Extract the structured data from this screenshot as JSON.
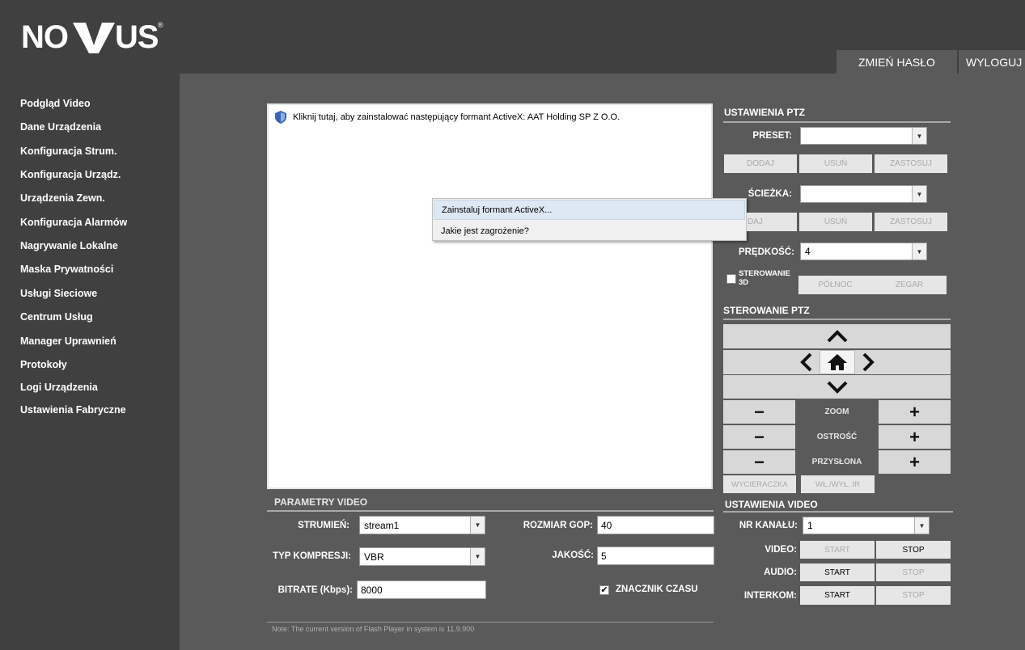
{
  "brand": {
    "logo_text": "NOVUS",
    "registered": "®"
  },
  "header": {
    "change_password": "ZMIEŃ HASŁO",
    "logout": "WYLOGUJ"
  },
  "sidebar": {
    "items": [
      "Podgląd Video",
      "Dane Urządzenia",
      "Konfiguracja Strum.",
      "Konfiguracja Urządz.",
      "Urządzenia Zewn.",
      "Konfiguracja Alarmów",
      "Nagrywanie Lokalne",
      "Maska Prywatności",
      "Usługi Sieciowe",
      "Centrum Usług",
      "Manager Uprawnień",
      "Protokoły",
      "Logi Urządzenia",
      "Ustawienia Fabryczne"
    ]
  },
  "viewer": {
    "activex_bar": "Kliknij tutaj, aby zainstalować następujący formant ActiveX: AAT Holding  SP Z O.O.",
    "menu": [
      "Zainstaluj formant ActiveX...",
      "Jakie jest zagrożenie?"
    ]
  },
  "ptz_settings": {
    "title": "USTAWIENIA PTZ",
    "preset_label": "PRESET:",
    "preset_value": "",
    "path_label": "ŚCIEŻKA:",
    "path_value": "",
    "speed_label": "PRĘDKOŚĆ:",
    "speed_value": "4",
    "add": "DODAJ",
    "remove": "USUŃ",
    "apply": "ZASTOSUJ",
    "add_partial": "DAJ",
    "control3d_label": "STEROWANIE 3D",
    "north": "PÓŁNOC",
    "clock": "ZEGAR"
  },
  "ptz_control": {
    "title": "STEROWANIE PTZ",
    "zoom": "ZOOM",
    "focus": "OSTROŚĆ",
    "iris": "PRZYSŁONA",
    "minus": "−",
    "plus": "+",
    "wiper": "WYCIERACZKA",
    "ir": "WŁ./WYŁ. IR"
  },
  "video_params": {
    "title": "PARAMETRY VIDEO",
    "stream_label": "STRUMIEŃ:",
    "stream_value": "stream1",
    "gop_label": "ROZMIAR GOP:",
    "gop_value": "40",
    "compression_label": "TYP KOMPRESJI:",
    "compression_value": "VBR",
    "quality_label": "JAKOŚĆ:",
    "quality_value": "5",
    "bitrate_label": "BITRATE (Kbps):",
    "bitrate_value": "8000",
    "timestamp_label": "ZNACZNIK CZASU",
    "timestamp_checked": true,
    "note": "Note: The current version of Flash Player in system is 11.9.900"
  },
  "video_settings": {
    "title": "USTAWIENIA VIDEO",
    "channel_label": "NR KANAŁU:",
    "channel_value": "1",
    "video_label": "VIDEO:",
    "audio_label": "AUDIO:",
    "intercom_label": "INTERKOM:",
    "start": "START",
    "stop": "STOP"
  },
  "colors": {
    "header": "#404040",
    "page": "#5a5a5a",
    "button": "#e6e6e6",
    "ptz_bar": "#d8d8d8"
  }
}
